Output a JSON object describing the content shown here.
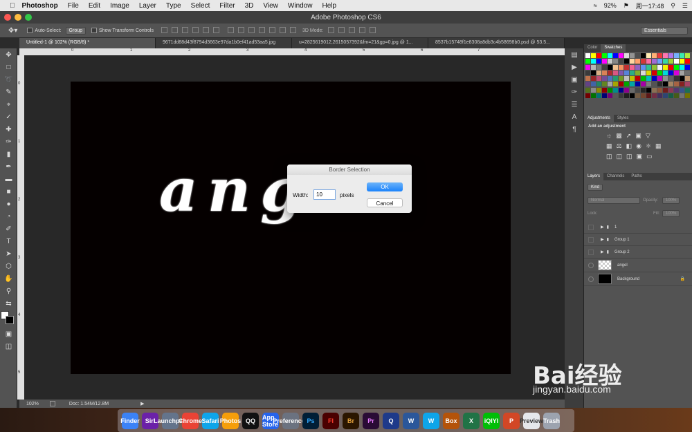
{
  "menubar": {
    "app": "Photoshop",
    "items": [
      "File",
      "Edit",
      "Image",
      "Layer",
      "Type",
      "Select",
      "Filter",
      "3D",
      "View",
      "Window",
      "Help"
    ],
    "battery": "92%",
    "clock": "周一17:48"
  },
  "window": {
    "title": "Adobe Photoshop CS6"
  },
  "options": {
    "auto_select": "Auto-Select:",
    "group": "Group",
    "show_transform": "Show Transform Controls",
    "mode3d": "3D Mode:",
    "workspace": "Essentials"
  },
  "tabs": [
    "Untitled-1 @ 102% (RGB/8) *",
    "9671dd88d43f8794d3663e97da1b0ef41ad53aa5.jpg",
    "u=2825619012,2615057392&fm=21&gp=0.jpg @ 1...",
    "8537b15748f1e8308a8db3c4b58698b0.psd @ 53.5..."
  ],
  "ruler_top": [
    "0",
    "1",
    "2",
    "3",
    "4",
    "5",
    "6",
    "7"
  ],
  "ruler_left": [
    "0",
    "1",
    "2",
    "3",
    "4",
    "5"
  ],
  "canvas": {
    "text": "ang"
  },
  "dialog": {
    "title": "Border Selection",
    "width_label": "Width:",
    "width_value": "10",
    "unit": "pixels",
    "ok": "OK",
    "cancel": "Cancel"
  },
  "status": {
    "zoom": "102%",
    "doc": "Doc: 1.54M/12.8M"
  },
  "panels": {
    "color_tab": "Color",
    "swatches_tab": "Swatches",
    "adjustments_tab": "Adjustments",
    "styles_tab": "Styles",
    "add_adjustment": "Add an adjustment",
    "layers_tab": "Layers",
    "channels_tab": "Channels",
    "paths_tab": "Paths",
    "kind": "Kind",
    "blend": "Normal",
    "opacity_label": "Opacity:",
    "opacity": "100%",
    "lock_label": "Lock:",
    "fill_label": "Fill:",
    "fill": "100%",
    "layers": [
      {
        "name": "1",
        "type": "group"
      },
      {
        "name": "Group 1",
        "type": "group"
      },
      {
        "name": "Group 2",
        "type": "group"
      },
      {
        "name": "angel",
        "type": "layer"
      },
      {
        "name": "Background",
        "type": "background"
      }
    ]
  },
  "colors": {
    "swatches": [
      "#ffffff",
      "#ffff00",
      "#ff0000",
      "#00ff00",
      "#00ffff",
      "#0000ff",
      "#ff00ff",
      "#c0c0c0",
      "#808080",
      "#444444",
      "#000000",
      "#ffcc99",
      "#ff9966",
      "#cc3333",
      "#ff6699",
      "#9966cc",
      "#6699ff",
      "#33cc99",
      "#99cc33"
    ]
  },
  "dock": [
    "Finder",
    "Siri",
    "Launchpad",
    "Chrome",
    "Safari",
    "Photos",
    "QQ",
    "App Store",
    "Preferences",
    "Ps",
    "Fl",
    "Br",
    "Pr",
    "Q",
    "W",
    "W",
    "Box",
    "X",
    "iQIYI",
    "P",
    "Preview",
    "Trash"
  ],
  "watermark": {
    "brand": "Bai经验",
    "url": "jingyan.baidu.com"
  }
}
